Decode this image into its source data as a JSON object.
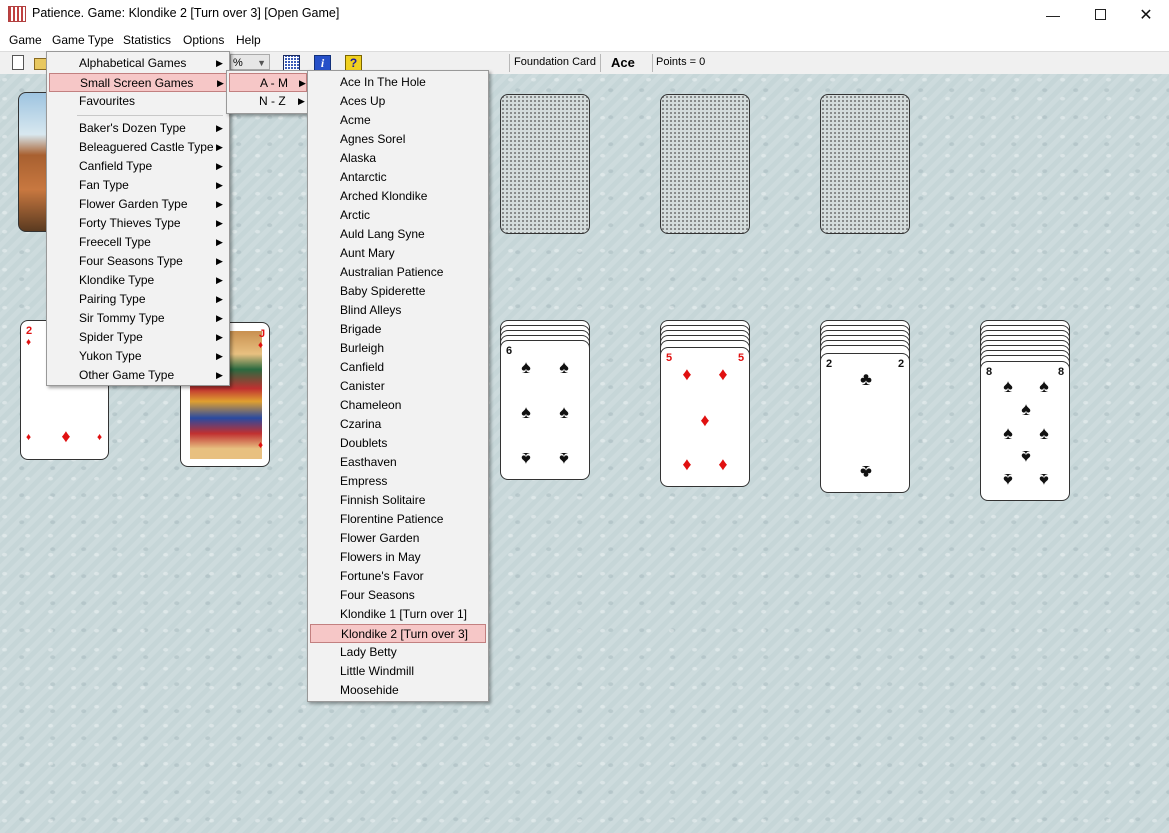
{
  "window": {
    "title": "Patience. Game: Klondike 2 [Turn over 3]  [Open Game]",
    "minimize_glyph": "—",
    "close_glyph": "✕"
  },
  "menubar": {
    "items": [
      "Game",
      "Game Type",
      "Statistics",
      "Options",
      "Help"
    ]
  },
  "toolbar": {
    "combo_value": "%",
    "foundation_label": "Foundation Card",
    "foundation_value": "Ace",
    "points": "Points = 0",
    "info_glyph": "i",
    "help_glyph": "?"
  },
  "game_type_menu": {
    "top_items": [
      "Alphabetical Games",
      "Small Screen Games",
      "Favourites"
    ],
    "type_items": [
      "Baker's Dozen Type",
      "Beleaguered Castle Type",
      "Canfield Type",
      "Fan Type",
      "Flower Garden Type",
      "Forty Thieves Type",
      "Freecell Type",
      "Four Seasons Type",
      "Klondike Type",
      "Pairing Type",
      "Sir Tommy Type",
      "Spider Type",
      "Yukon Type",
      "Other Game Type"
    ],
    "highlighted": "Small Screen Games"
  },
  "range_menu": {
    "items": [
      "A - M",
      "N - Z"
    ],
    "highlighted": "A - M"
  },
  "games_menu": {
    "items": [
      "Ace In The Hole",
      "Aces Up",
      "Acme",
      "Agnes Sorel",
      "Alaska",
      "Antarctic",
      "Arched Klondike",
      "Arctic",
      "Auld Lang Syne",
      "Aunt Mary",
      "Australian Patience",
      "Baby Spiderette",
      "Blind Alleys",
      "Brigade",
      "Burleigh",
      "Canfield",
      "Canister",
      "Chameleon",
      "Czarina",
      "Doublets",
      "Easthaven",
      "Empress",
      "Finnish Solitaire",
      "Florentine Patience",
      "Flower Garden",
      "Flowers in May",
      "Fortune's Favor",
      "Four Seasons",
      "Klondike 1 [Turn over 1]",
      "Klondike 2 [Turn over 3]",
      "Lady Betty",
      "Little Windmill",
      "Moosehide"
    ],
    "highlighted": "Klondike 2 [Turn over 3]"
  },
  "tableau": {
    "cards": [
      {
        "rank": "2",
        "suit": "♦",
        "color": "red"
      },
      {
        "rank": "J",
        "suit": "♦",
        "color": "red"
      },
      {
        "rank": "6",
        "suit": "♠",
        "color": "black"
      },
      {
        "rank": "5",
        "suit": "♦",
        "color": "red"
      },
      {
        "rank": "2",
        "suit": "♣",
        "color": "black"
      },
      {
        "rank": "8",
        "suit": "♠",
        "color": "black"
      }
    ]
  },
  "colors": {
    "board": "#c6d6d8",
    "menu_highlight": "#f6c7c7",
    "red_suit": "#e01010"
  }
}
